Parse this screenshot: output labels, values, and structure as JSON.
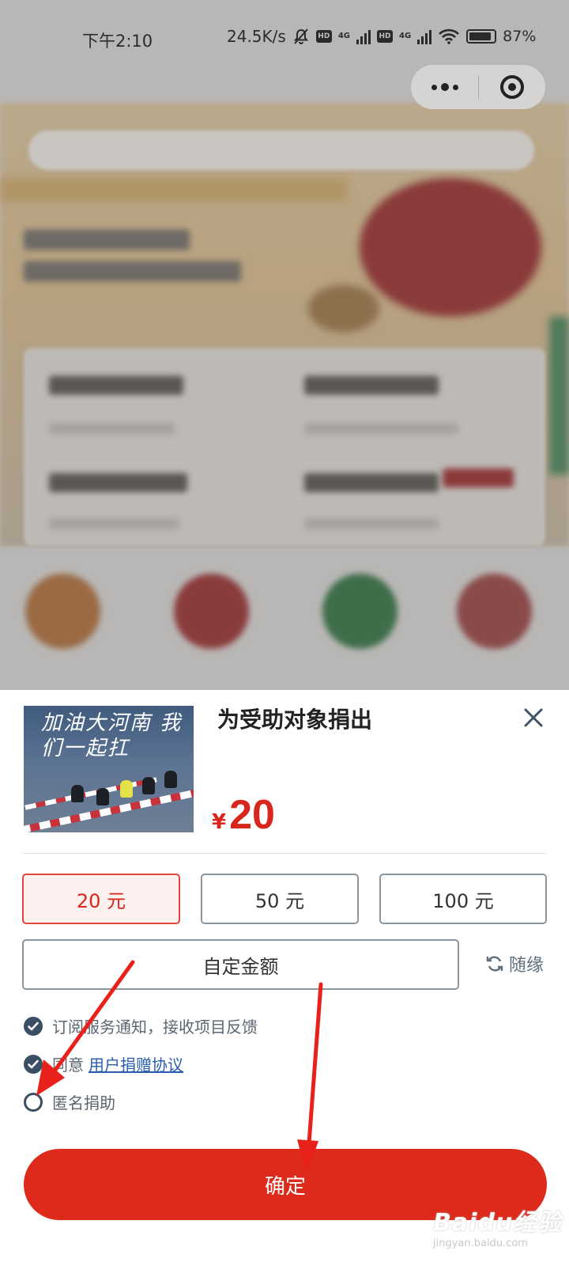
{
  "status_bar": {
    "time": "下午2:10",
    "net_speed": "24.5K/s",
    "hd_label": "HD",
    "net_label": "4G",
    "battery": "87%"
  },
  "capsule": {
    "more_icon": "more-dots-icon",
    "close_icon": "target-close-icon"
  },
  "sheet": {
    "title": "为受助对象捐出",
    "image_text": "加油大河南 我们一起扛",
    "price_symbol": "¥",
    "price_value": "20",
    "amounts": [
      {
        "label": "20 元",
        "selected": true
      },
      {
        "label": "50 元",
        "selected": false
      },
      {
        "label": "100 元",
        "selected": false
      }
    ],
    "custom_amount_label": "自定金额",
    "random_label": "随缘",
    "options": {
      "subscribe": {
        "label": "订阅服务通知，接收项目反馈",
        "checked": true
      },
      "agree": {
        "prefix": "同意",
        "link": "用户捐赠协议",
        "checked": true
      },
      "anonymous": {
        "label": "匿名捐助",
        "checked": false
      }
    },
    "confirm_label": "确定"
  },
  "watermark": {
    "brand": "Baidu经验",
    "url": "jingyan.baidu.com"
  },
  "colors": {
    "accent": "#dd2a1b",
    "check": "#3a4f63",
    "link": "#2a5db0"
  }
}
